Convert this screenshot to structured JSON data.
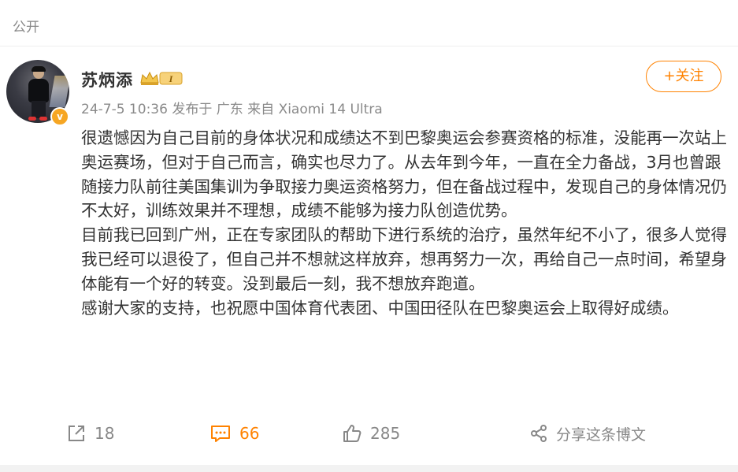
{
  "visibility": "公开",
  "user": {
    "name": "苏炳添",
    "avatar_badge": "v",
    "level_badge": "I"
  },
  "meta": {
    "time": "24-7-5 10:36",
    "location": "发布于 广东",
    "source": "来自 Xiaomi 14 Ultra"
  },
  "follow_label": "+关注",
  "content": {
    "paragraphs": [
      "很遗憾因为自己目前的身体状况和成绩达不到巴黎奥运会参赛资格的标准，没能再一次站上奥运赛场，但对于自己而言，确实也尽力了。从去年到今年，一直在全力备战，3月也曾跟随接力队前往美国集训为争取接力奥运资格努力，但在备战过程中，发现自己的身体情况仍不太好，训练效果并不理想，成绩不能够为接力队创造优势。",
      "目前我已回到广州，正在专家团队的帮助下进行系统的治疗，虽然年纪不小了，很多人觉得我已经可以退役了，但自己并不想就这样放弃，想再努力一次，再给自己一点时间，希望身体能有一个好的转变。没到最后一刻，我不想放弃跑道。",
      "感谢大家的支持，也祝愿中国体育代表团、中国田径队在巴黎奥运会上取得好成绩。"
    ]
  },
  "actions": {
    "repost_count": "18",
    "comment_count": "66",
    "like_count": "285",
    "share_label": "分享这条博文"
  },
  "colors": {
    "accent": "#ff8200",
    "text": "#333333",
    "muted": "#888888"
  }
}
